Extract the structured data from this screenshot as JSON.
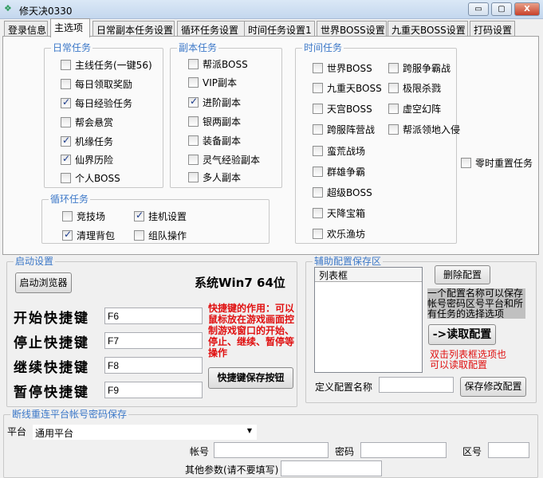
{
  "window": {
    "title": "修天决0330",
    "min": "▭",
    "max": "▢",
    "close": "X"
  },
  "tabs": [
    "登录信息",
    "主选项",
    "日常副本任务设置",
    "循环任务设置",
    "时间任务设置1",
    "世界BOSS设置",
    "九重天BOSS设置",
    "打码设置"
  ],
  "daily": {
    "label": "日常任务",
    "items": [
      {
        "label": "主线任务(一键56)",
        "checked": false
      },
      {
        "label": "每日领取奖励",
        "checked": false
      },
      {
        "label": "每日经验任务",
        "checked": true
      },
      {
        "label": "帮会悬赏",
        "checked": false
      },
      {
        "label": "机缘任务",
        "checked": true
      },
      {
        "label": "仙界历险",
        "checked": true
      },
      {
        "label": "个人BOSS",
        "checked": false
      }
    ]
  },
  "dungeon": {
    "label": "副本任务",
    "items": [
      {
        "label": "帮派BOSS",
        "checked": false
      },
      {
        "label": "VIP副本",
        "checked": false
      },
      {
        "label": "进阶副本",
        "checked": true
      },
      {
        "label": "银两副本",
        "checked": false
      },
      {
        "label": "装备副本",
        "checked": false
      },
      {
        "label": "灵气经验副本",
        "checked": false
      },
      {
        "label": "多人副本",
        "checked": false
      }
    ]
  },
  "timed": {
    "label": "时间任务",
    "items": [
      {
        "label": "世界BOSS",
        "checked": false
      },
      {
        "label": "九重天BOSS",
        "checked": false
      },
      {
        "label": "天宫BOSS",
        "checked": false
      },
      {
        "label": "跨服阵营战",
        "checked": false
      },
      {
        "label": "蛮荒战场",
        "checked": false
      },
      {
        "label": "群雄争霸",
        "checked": false
      },
      {
        "label": "超级BOSS",
        "checked": false
      },
      {
        "label": "天降宝箱",
        "checked": false
      },
      {
        "label": "欢乐渔坊",
        "checked": false
      },
      {
        "label": "跨服争霸战",
        "checked": false
      },
      {
        "label": "极限杀戮",
        "checked": false
      },
      {
        "label": "虚空幻阵",
        "checked": false
      },
      {
        "label": "帮派领地入侵",
        "checked": false
      }
    ]
  },
  "loop": {
    "label": "循环任务",
    "items": [
      {
        "label": "竞技场",
        "checked": false
      },
      {
        "label": "挂机设置",
        "checked": true
      },
      {
        "label": "清理背包",
        "checked": true
      },
      {
        "label": "组队操作",
        "checked": false
      }
    ]
  },
  "reset": {
    "label": "零时重置任务",
    "checked": false
  },
  "startup": {
    "label": "启动设置",
    "launch": "启动浏览器",
    "system": "系统Win7  64位",
    "hotkeys": [
      {
        "label": "开始快捷键",
        "value": "F6"
      },
      {
        "label": "停止快捷键",
        "value": "F7"
      },
      {
        "label": "继续快捷键",
        "value": "F8"
      },
      {
        "label": "暂停快捷键",
        "value": "F9"
      }
    ],
    "note": "快捷键的作用：可以鼠标放在游戏画面控制游戏窗口的开始、停止、继续、暂停等操作",
    "save": "快捷键保存按钮"
  },
  "config": {
    "label": "辅助配置保存区",
    "list_header": "列表框",
    "delete": "删除配置",
    "info": "一个配置名称可以保存帐号密码区号平台和所有任务的选择选项",
    "read": "->读取配置",
    "hint": "双击列表框选项也可以读取配置",
    "name_label": "定义配置名称",
    "name_value": "",
    "save": "保存修改配置"
  },
  "reconnect": {
    "label": "断线重连平台帐号密码保存",
    "platform_label": "平台",
    "platform": "通用平台",
    "account_label": "帐号",
    "account": "",
    "password_label": "密码",
    "password": "",
    "zone_label": "区号",
    "zone": "",
    "other_label": "其他参数(请不要填写)",
    "other": ""
  }
}
